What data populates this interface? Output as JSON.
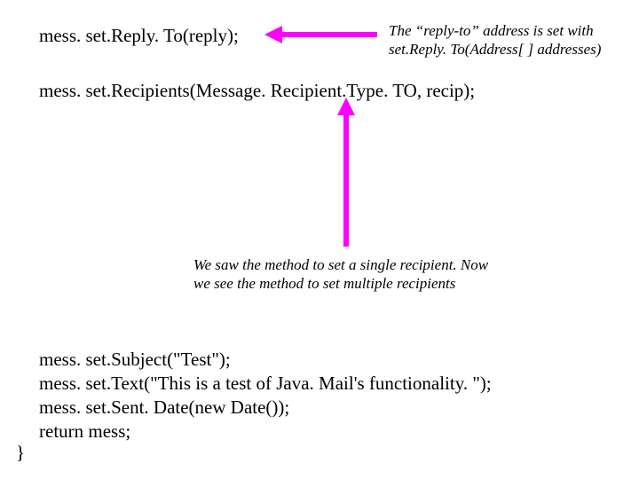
{
  "code": {
    "line1": "mess. set.Reply. To(reply);",
    "line2": "mess. set.Recipients(Message. Recipient.Type. TO, recip);",
    "block_line1": "mess. set.Subject(\"Test\");",
    "block_line2": "mess. set.Text(\"This is a test of Java. Mail's functionality. \");",
    "block_line3": "mess. set.Sent. Date(new Date());",
    "block_line4": "return mess;",
    "close_brace": "}"
  },
  "annotations": {
    "a1_line1": "The “reply-to” address is set with",
    "a1_line2": "set.Reply. To(Address[ ] addresses)",
    "a2_line1": "We saw the method to set a single recipient. Now",
    "a2_line2": "we see the method to set multiple recipients"
  },
  "colors": {
    "arrow": "#ff00ff"
  }
}
